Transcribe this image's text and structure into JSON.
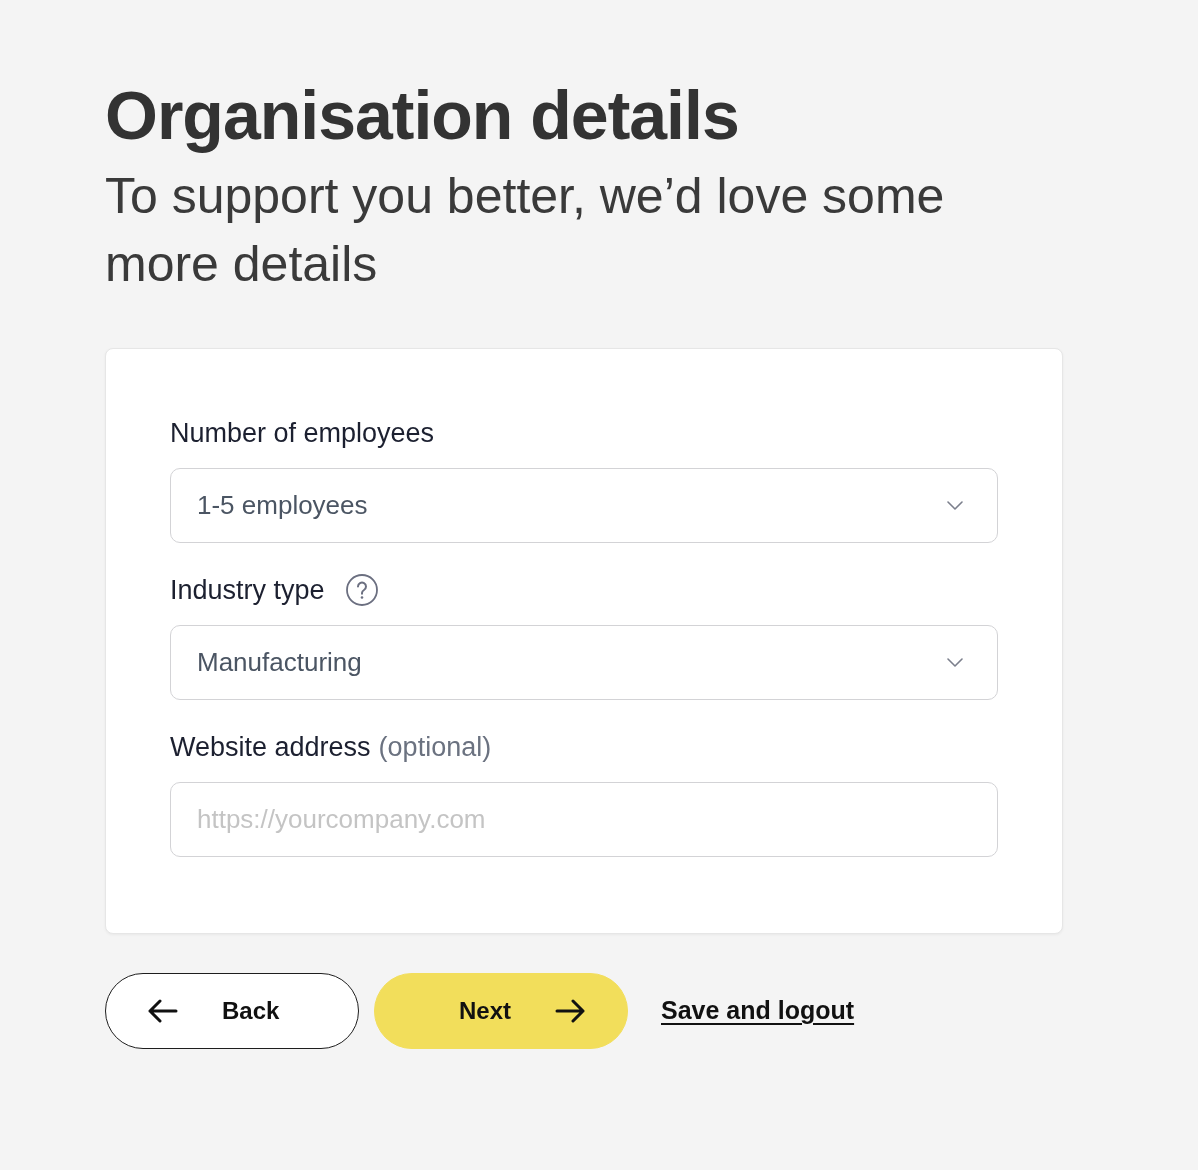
{
  "page": {
    "title": "Organisation details",
    "subtitle": "To support you better, we’d love some more details"
  },
  "form": {
    "fields": [
      {
        "kind": "select",
        "label": "Number of employees",
        "help": false,
        "value": "1-5 employees"
      },
      {
        "kind": "select",
        "label": "Industry type",
        "help": true,
        "value": "Manufacturing"
      },
      {
        "kind": "text",
        "label": "Website address",
        "help": false,
        "note": "(optional)",
        "placeholder": "https://yourcompany.com"
      }
    ]
  },
  "actions": [
    {
      "kind": "back",
      "label": "Back"
    },
    {
      "kind": "next",
      "label": "Next"
    },
    {
      "kind": "link",
      "label": "Save and logout"
    }
  ]
}
